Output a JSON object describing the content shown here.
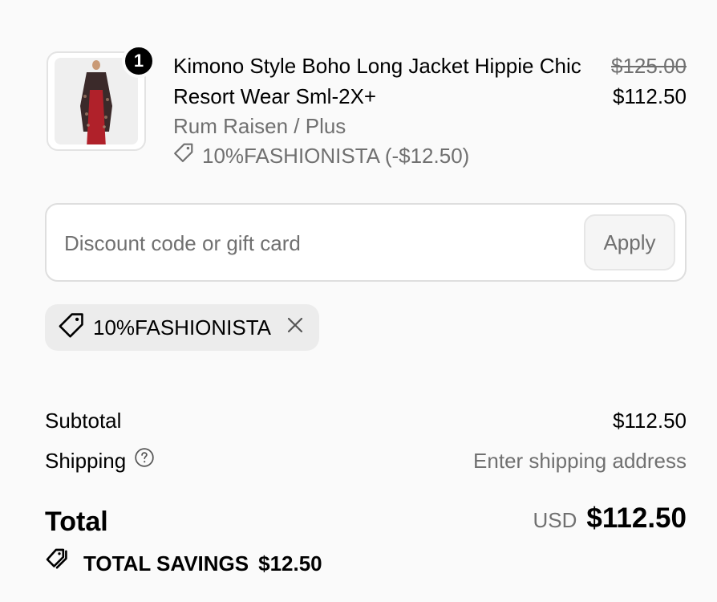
{
  "line_item": {
    "quantity": "1",
    "title": "Kimono Style Boho Long Jacket Hippie Chic Resort Wear Sml-2X+",
    "variant": "Rum Raisen / Plus",
    "discount_line": "10%FASHIONISTA (-$12.50)",
    "price_original": "$125.00",
    "price_sale": "$112.50"
  },
  "discount": {
    "placeholder": "Discount code or gift card",
    "value": "",
    "apply_label": "Apply",
    "applied_code": "10%FASHIONISTA"
  },
  "summary": {
    "subtotal_label": "Subtotal",
    "subtotal_value": "$112.50",
    "shipping_label": "Shipping",
    "shipping_value": "Enter shipping address",
    "total_label": "Total",
    "currency": "USD",
    "total_value": "$112.50",
    "savings_label": "TOTAL SAVINGS",
    "savings_value": "$12.50"
  },
  "colors": {
    "background": "#fafafa",
    "muted_text": "#707070",
    "chip_bg": "#ececec",
    "garment_red": "#b0212a"
  },
  "icons": {
    "discount_tag": "tag-icon",
    "remove": "close-icon",
    "shipping_help": "question-circle-icon",
    "savings": "tags-icon"
  }
}
